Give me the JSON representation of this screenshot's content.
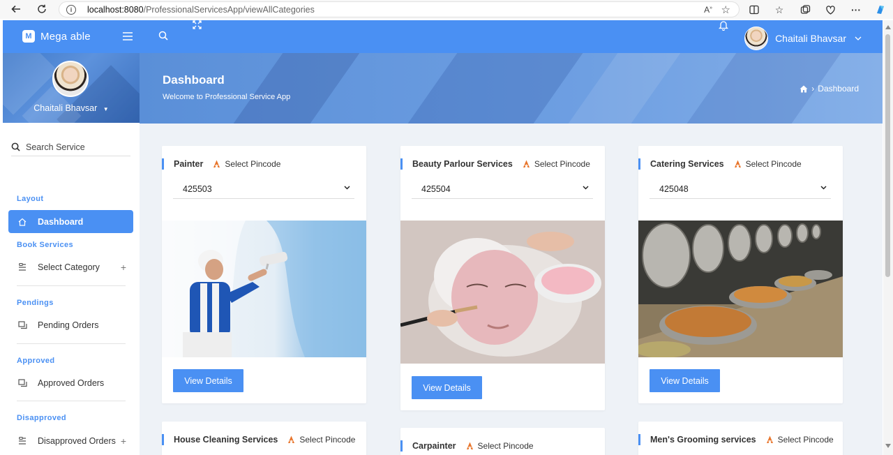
{
  "browser": {
    "url_host": "localhost:8080",
    "url_path": "/ProfessionalServicesApp/viewAllCategories"
  },
  "app": {
    "brand": "Mega able",
    "user_name": "Chaitali Bhavsar"
  },
  "sidebar": {
    "user_name": "Chaitali Bhavsar",
    "search_label": "Search Service",
    "sections": [
      {
        "caption": "Layout",
        "item": "Dashboard"
      },
      {
        "caption": "Book Services",
        "item": "Select Category"
      },
      {
        "caption": "Pendings",
        "item": "Pending Orders"
      },
      {
        "caption": "Approved",
        "item": "Approved Orders"
      },
      {
        "caption": "Disapproved",
        "item": "Disapproved Orders"
      }
    ]
  },
  "header": {
    "title": "Dashboard",
    "subtitle": "Welcome to Professional Service App",
    "breadcrumb": "Dashboard"
  },
  "cards": [
    {
      "title": "Painter",
      "pin_label": "Select Pincode",
      "pincode": "425503",
      "button": "View Details"
    },
    {
      "title": "Beauty Parlour Services",
      "pin_label": "Select Pincode",
      "pincode": "425504",
      "button": "View Details"
    },
    {
      "title": "Catering Services",
      "pin_label": "Select Pincode",
      "pincode": "425048",
      "button": "View Details"
    },
    {
      "title": "House Cleaning Services",
      "pin_label": "Select Pincode"
    },
    {
      "title": "Carpainter",
      "pin_label": "Select Pincode"
    },
    {
      "title": "Men's Grooming services",
      "pin_label": "Select Pincode"
    }
  ],
  "colors": {
    "primary": "#4a90f3",
    "pin_icon": "#e8742a"
  }
}
